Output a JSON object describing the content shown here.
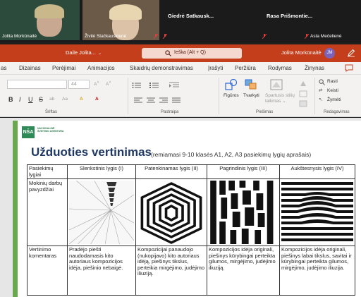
{
  "meeting": {
    "participants": [
      {
        "name": "Jolita Morkūnaitė",
        "muted": false
      },
      {
        "name": "Živilė Stačkauskienė",
        "muted": true
      },
      {
        "name": "Giedrė Satkausk...",
        "muted": true
      },
      {
        "name": "Rasa Prišmontie...",
        "muted": true
      },
      {
        "name": "Asta Mečelienė",
        "muted": true
      }
    ]
  },
  "ppt": {
    "doc_title": "Daile Jolita...",
    "search_placeholder": "Ieška (Alt + Q)",
    "user_name": "Jolita Morkūnaitė",
    "user_initials": "JM",
    "menu": [
      "as",
      "Dizainas",
      "Perėjimai",
      "Animacijos",
      "Skaidrių demonstravimas",
      "Įrašyti",
      "Peržiūra",
      "Rodymas",
      "Žinynas"
    ],
    "ribbon": {
      "font_size": "44",
      "bold": "B",
      "italic": "I",
      "underline": "U",
      "strike": "S",
      "shapes_label": "Figūros",
      "arrange_label": "Tvarkyti",
      "styles_label": "Spartusis stilių\ntalkmas",
      "find_label": "Rasti",
      "replace_label": "Keisti",
      "select_label": "Žymėti",
      "groups": [
        "Šriftas",
        "Pastraipa",
        "Piešimas",
        "Redagavimas"
      ]
    }
  },
  "slide": {
    "logo_abbr": "NŠA",
    "logo_text": "NACIONALINĖ ŠVIETIMO AGENTŪRA",
    "title": "Užduoties vertinimas",
    "subtitle": "(remiamasi 9-10 klasės A1, A2, A3 pasiekimų lygių aprašais)",
    "table": {
      "headers": [
        "Pasiekimų lygiai",
        "Slenkstinis lygis (I)",
        "Patenkinamas lygis (II)",
        "Pagrindinis lygis (III)",
        "Aukštesnysis lygis (IV)"
      ],
      "row_works": "Mokinių darbų pavyzdžiai",
      "row_comments": "Vertinimo komentaras",
      "comments": [
        "Pradėjo piešti naudodamasis kito autoriaus kompozicijos idėja, piešinio nebaigė.",
        "Kompozicijai panaudojo (nukopijavo) kito autoriaus idėją, piešinys tikslus, perteikia mirgėjimo, judėjimo iliuziją.",
        "Kompozicijos idėja originali, piešinys kūrybingai perteikta gilumos, mirgėjimo, judėjimo iliuziją.",
        "Kompozicijos idėja originali, piešinys labai tikslus, savitai ir kūrybingai perteikta gilumos, mirgėjimo, judėjimo iliuzija."
      ]
    }
  },
  "colors": {
    "ppt_accent": "#c43e1c",
    "slide_title": "#1f3864",
    "slide_bar": "#6aa84f",
    "logo": "#2e8b57"
  }
}
